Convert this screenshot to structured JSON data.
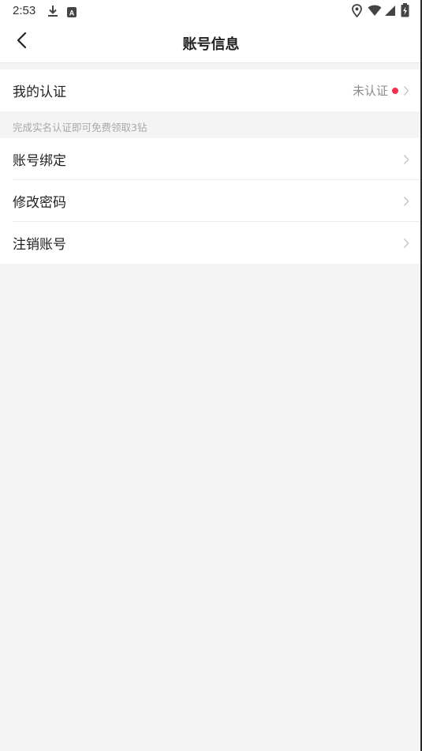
{
  "status_bar": {
    "time": "2:53",
    "icons": [
      "download-icon",
      "a-badge-icon",
      "location-icon",
      "wifi-icon",
      "signal-icon",
      "battery-icon"
    ]
  },
  "header": {
    "title": "账号信息",
    "back_icon": "back-arrow-icon"
  },
  "verification": {
    "label": "我的认证",
    "status": "未认证",
    "dot_color": "#f2304d",
    "hint": "完成实名认证即可免费领取3钻"
  },
  "menu": [
    {
      "label": "账号绑定"
    },
    {
      "label": "修改密码"
    },
    {
      "label": "注销账号"
    }
  ],
  "colors": {
    "background": "#f4f4f5",
    "surface": "#ffffff",
    "accent_red": "#f2304d"
  }
}
